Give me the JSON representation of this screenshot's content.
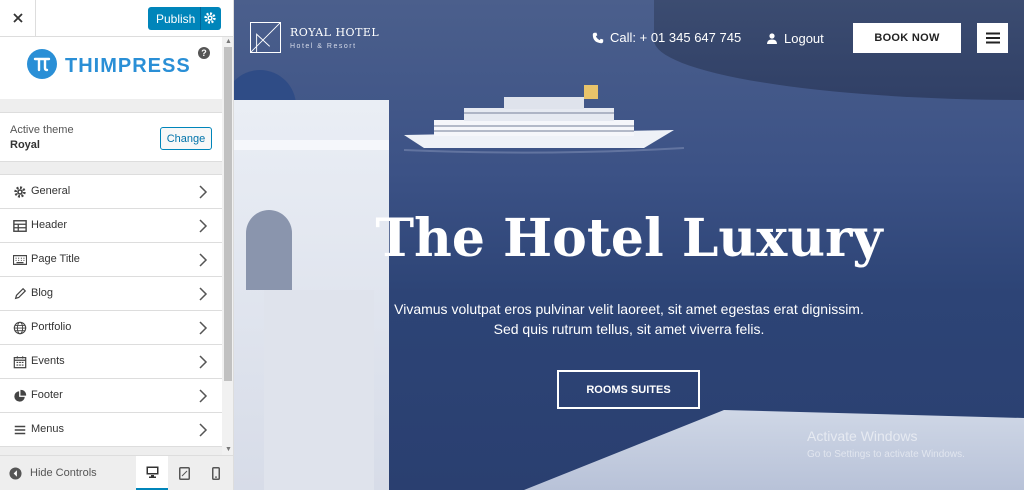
{
  "customizer": {
    "close_icon": "close-icon",
    "publish_label": "Publish",
    "brand_logo_text": "THIMPRESS",
    "help_symbol": "?",
    "active_theme_caption": "Active theme",
    "active_theme_name": "Royal",
    "change_label": "Change",
    "sections": [
      {
        "label": "General",
        "icon": "gear-icon"
      },
      {
        "label": "Header",
        "icon": "table-icon"
      },
      {
        "label": "Page Title",
        "icon": "keyboard-icon"
      },
      {
        "label": "Blog",
        "icon": "pencil-icon"
      },
      {
        "label": "Portfolio",
        "icon": "globe-icon"
      },
      {
        "label": "Events",
        "icon": "calendar-icon"
      },
      {
        "label": "Footer",
        "icon": "pie-chart-icon"
      },
      {
        "label": "Menus",
        "icon": "list-icon"
      }
    ],
    "hide_controls_label": "Hide Controls",
    "devices": [
      "desktop",
      "tablet",
      "mobile"
    ],
    "accent_color": "#0085ba"
  },
  "site": {
    "brand_name": "ROYAL HOTEL",
    "brand_tagline": "Hotel & Resort",
    "call_text": "Call: + 01 345 647 745",
    "logout_label": "Logout",
    "book_now_label": "BOOK NOW",
    "hero_title": "The Hotel Luxury",
    "hero_text": "Vivamus volutpat eros pulvinar velit laoreet, sit amet egestas erat dignissim. Sed quis rutrum tellus, sit amet viverra felis.",
    "rooms_button_label": "ROOMS SUITES"
  },
  "windows_watermark": {
    "title": "Activate Windows",
    "subtitle": "Go to Settings to activate Windows."
  }
}
